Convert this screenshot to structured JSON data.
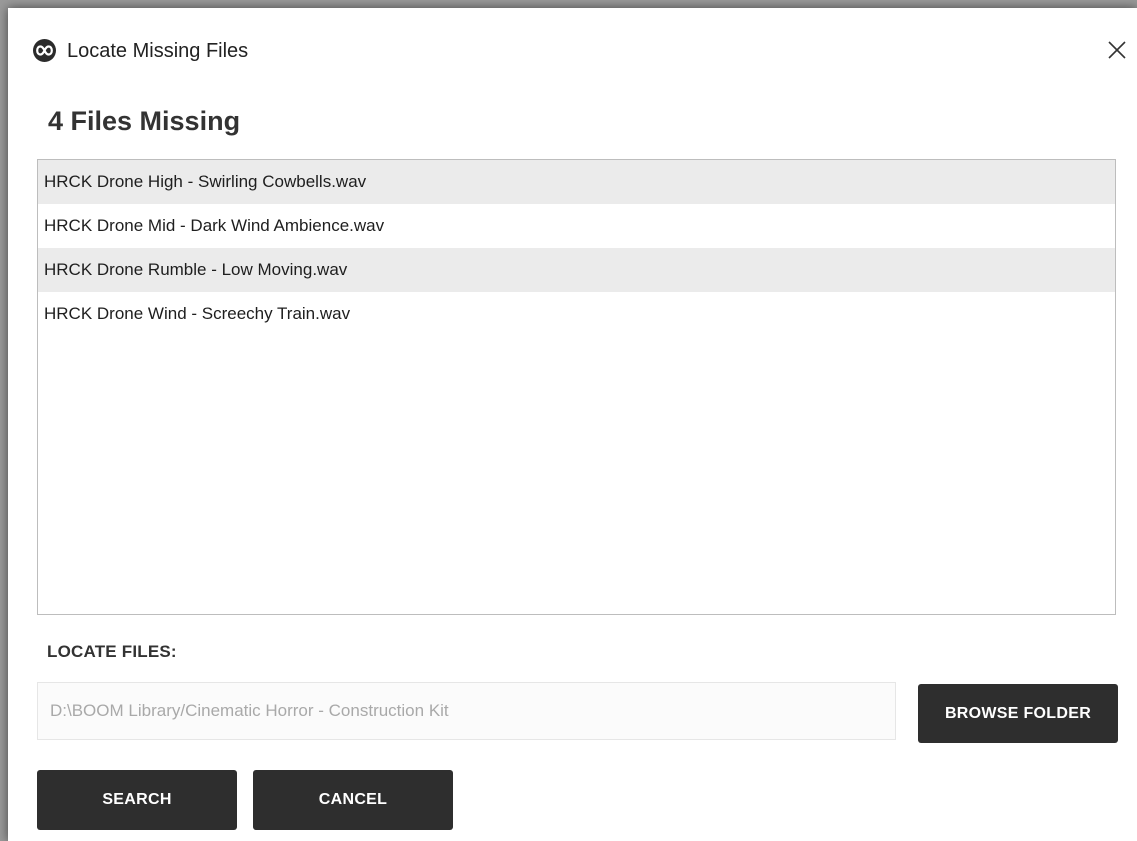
{
  "window": {
    "title": "Locate Missing Files",
    "app_icon": "infinity-logo-icon",
    "close_icon": "close-icon"
  },
  "heading": "4 Files Missing",
  "files": [
    "HRCK Drone High - Swirling Cowbells.wav",
    "HRCK Drone Mid - Dark Wind Ambience.wav",
    "HRCK Drone Rumble - Low Moving.wav",
    "HRCK Drone Wind - Screechy Train.wav"
  ],
  "locate": {
    "label": "LOCATE FILES:",
    "path_value": "D:\\BOOM Library/Cinematic Horror - Construction Kit",
    "browse_label": "BROWSE FOLDER"
  },
  "actions": {
    "search_label": "SEARCH",
    "cancel_label": "CANCEL"
  },
  "colors": {
    "button_bg": "#2e2e2e",
    "row_shade": "#ebebeb",
    "placeholder_text": "#a9a9a9"
  }
}
